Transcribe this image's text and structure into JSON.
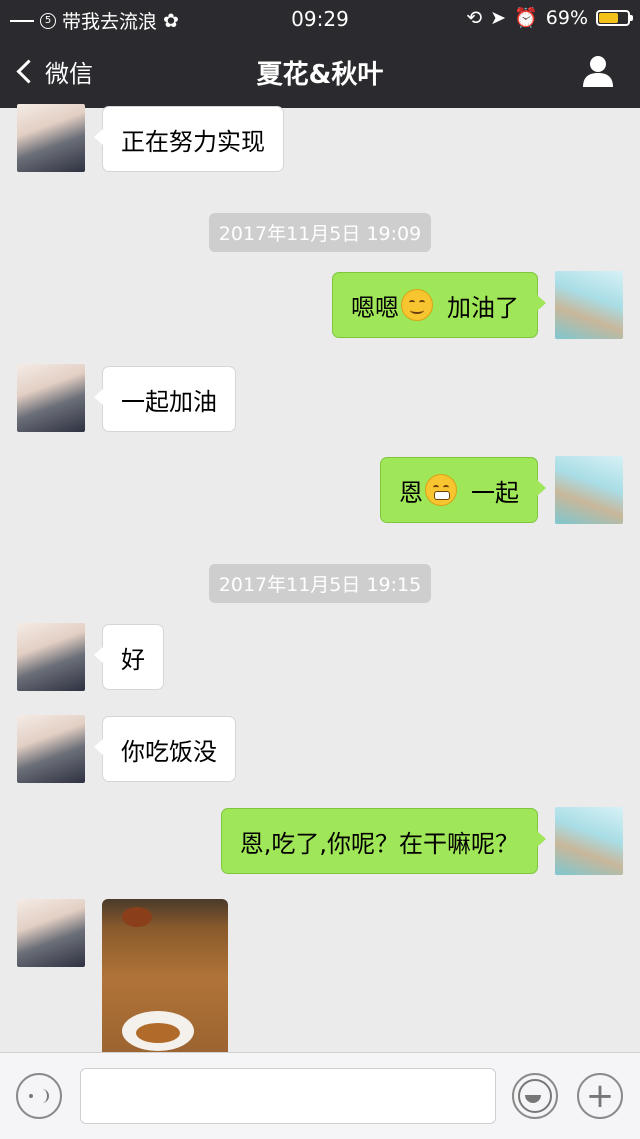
{
  "status_bar": {
    "carrier": "带我去流浪",
    "sim_badge": "5",
    "time": "09:29",
    "battery": "69%",
    "battery_level": 0.69
  },
  "nav": {
    "back_label": "微信",
    "title": "夏花&秋叶"
  },
  "messages": [
    {
      "side": "in",
      "text": "正在努力实现"
    },
    {
      "type": "timestamp",
      "text": "2017年11月5日 19:09"
    },
    {
      "side": "out",
      "text_before": "嗯嗯",
      "emoji": "smile",
      "text_after": "加油了"
    },
    {
      "side": "in",
      "text": "一起加油"
    },
    {
      "side": "out",
      "text_before": "恩",
      "emoji": "grin",
      "text_after": "一起"
    },
    {
      "type": "timestamp",
      "text": "2017年11月5日 19:15"
    },
    {
      "side": "in",
      "text": "好"
    },
    {
      "side": "in",
      "text": "你吃饭没"
    },
    {
      "side": "out",
      "text": "恩,吃了,你呢？在干嘛呢？"
    },
    {
      "side": "in",
      "type": "image"
    }
  ],
  "input_bar": {
    "voice_icon": "voice-icon",
    "emoji_icon": "emoji-icon",
    "plus_icon": "+"
  }
}
